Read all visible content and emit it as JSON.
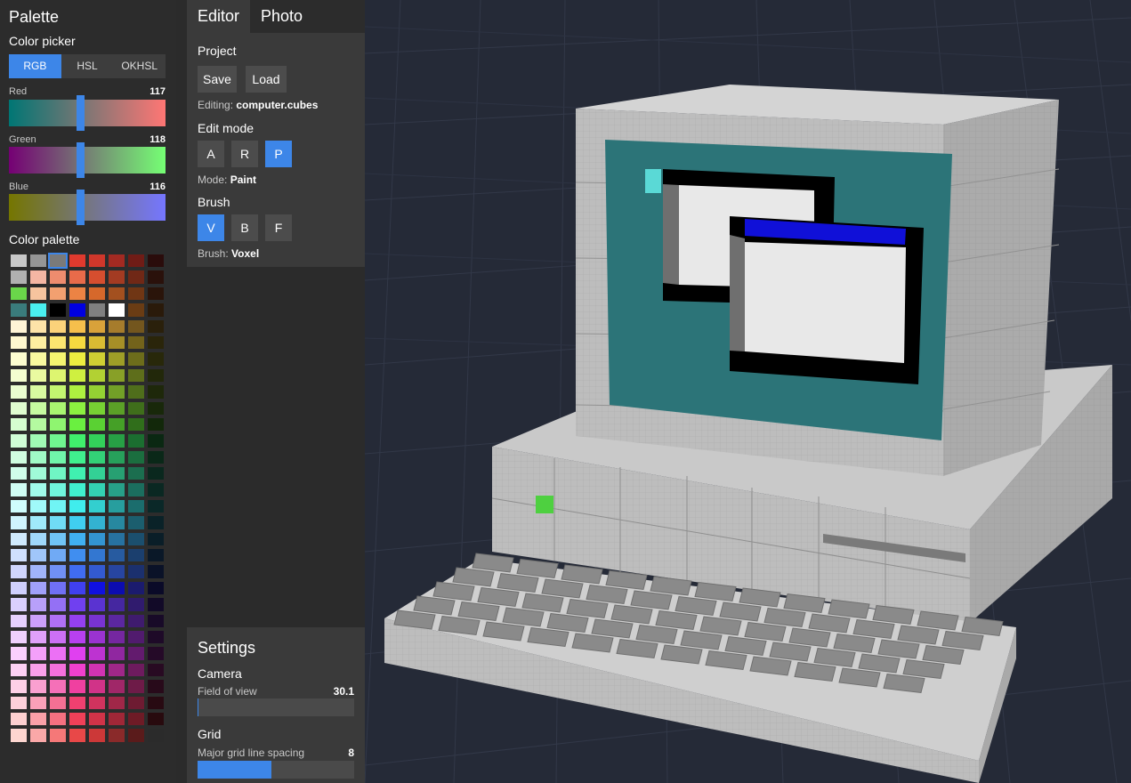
{
  "palette": {
    "title": "Palette",
    "color_picker_label": "Color picker",
    "modes": [
      "RGB",
      "HSL",
      "OKHSL"
    ],
    "active_mode": "RGB",
    "sliders": [
      {
        "label": "Red",
        "value": 117
      },
      {
        "label": "Green",
        "value": 118
      },
      {
        "label": "Blue",
        "value": 116
      }
    ],
    "color_palette_label": "Color palette",
    "swatches": [
      [
        "#c8c8c8",
        "#959595",
        "#7a7a7a",
        "#e03a2e",
        "#d0372b",
        "#a32a22",
        "#701c16",
        "#2a0c0b"
      ],
      [
        "#b0b0b0",
        "#f4b6a3",
        "#ee8c6e",
        "#e86b4a",
        "#d64e2f",
        "#a33b22",
        "#702816",
        "#2a110b"
      ],
      [
        "#6ad64a",
        "#f6c49e",
        "#f2a070",
        "#ec8344",
        "#d6682b",
        "#a3501f",
        "#703614",
        "#2a140a"
      ],
      [
        "#3a7c7c",
        "#4af0f0",
        "#000000",
        "#0000e0",
        "#808080",
        "#ffffff",
        "#6a3c14",
        "#2a1a0a"
      ],
      [
        "#fff4d6",
        "#fde3a8",
        "#fbd27a",
        "#f6bf4c",
        "#d9a23a",
        "#a67c2c",
        "#73561e",
        "#2a200b"
      ],
      [
        "#fff8d0",
        "#fdeea0",
        "#fbe570",
        "#f6d940",
        "#d9bb33",
        "#a68f27",
        "#73631b",
        "#2a250a"
      ],
      [
        "#fdfdd0",
        "#f9f9a0",
        "#f4f470",
        "#eded40",
        "#cfcf33",
        "#9e9e27",
        "#6d6d1b",
        "#28280a"
      ],
      [
        "#f4fdd0",
        "#eafaa0",
        "#ddf570",
        "#cff040",
        "#b2d133",
        "#88a027",
        "#5e6e1b",
        "#22280a"
      ],
      [
        "#eafdd0",
        "#d8faa0",
        "#c3f570",
        "#aef040",
        "#94d133",
        "#72a027",
        "#4f6e1b",
        "#1e280a"
      ],
      [
        "#e0fdd0",
        "#c6faa0",
        "#a9f570",
        "#8cf040",
        "#77d133",
        "#5ba027",
        "#3f6e1b",
        "#18280a"
      ],
      [
        "#d6fdd0",
        "#b4faa0",
        "#8ff570",
        "#6af040",
        "#5ad133",
        "#45a027",
        "#306e1b",
        "#12280a"
      ],
      [
        "#d0fdd6",
        "#a0fab4",
        "#70f590",
        "#40f06c",
        "#33d15a",
        "#27a045",
        "#1b6e30",
        "#0a2812"
      ],
      [
        "#d0fde0",
        "#a0fac6",
        "#70f5aa",
        "#40f08e",
        "#33d177",
        "#27a05b",
        "#1b6e3f",
        "#0a2818"
      ],
      [
        "#d0fdea",
        "#a0fad8",
        "#70f5c4",
        "#40f0b0",
        "#33d195",
        "#27a072",
        "#1b6e4f",
        "#0a281e"
      ],
      [
        "#d0fdf4",
        "#a0faea",
        "#70f5dc",
        "#40f0ce",
        "#33d1b2",
        "#27a088",
        "#1b6e5e",
        "#0a2822"
      ],
      [
        "#d0fdfd",
        "#a0f9f9",
        "#70f4f4",
        "#40eded",
        "#33cfcf",
        "#279e9e",
        "#1b6d6d",
        "#0a2828"
      ],
      [
        "#d0f4fd",
        "#a0eafa",
        "#70dcf5",
        "#40cef0",
        "#33b2d1",
        "#2788a0",
        "#1b5e6e",
        "#0a2228"
      ],
      [
        "#d0eafd",
        "#a0d8fa",
        "#70c4f5",
        "#40b0f0",
        "#3395d1",
        "#2772a0",
        "#1b4f6e",
        "#0a1e28"
      ],
      [
        "#d0e0fd",
        "#a0c6fa",
        "#70aaf5",
        "#408ef0",
        "#3377d1",
        "#275ba0",
        "#1b3f6e",
        "#0a1828"
      ],
      [
        "#d0d6fd",
        "#a0b4fa",
        "#7090f5",
        "#406cf0",
        "#335ad1",
        "#2745a0",
        "#1b306e",
        "#0a1228"
      ],
      [
        "#d0d0fd",
        "#a0a0fa",
        "#7070f5",
        "#4040f0",
        "#1010e0",
        "#0c0cb0",
        "#1b1b6e",
        "#0a0a28"
      ],
      [
        "#dad0fd",
        "#b8a0fa",
        "#9470f5",
        "#7040f0",
        "#5a33d1",
        "#4527a0",
        "#301b6e",
        "#120a28"
      ],
      [
        "#e6d0fd",
        "#cca0fa",
        "#b070f5",
        "#9440f0",
        "#7833d1",
        "#5b27a0",
        "#3f1b6e",
        "#180a28"
      ],
      [
        "#f0d0fd",
        "#e0a0fa",
        "#cc70f5",
        "#b840f0",
        "#9a33d1",
        "#7527a0",
        "#511b6e",
        "#1e0a28"
      ],
      [
        "#fad0fd",
        "#f4a0fa",
        "#ec70f5",
        "#e040f0",
        "#bd33d1",
        "#9027a0",
        "#631b6e",
        "#250a28"
      ],
      [
        "#fdd0f4",
        "#faa0ea",
        "#f570dc",
        "#f040ce",
        "#d133b2",
        "#a02788",
        "#6e1b5e",
        "#280a22"
      ],
      [
        "#fdd0e6",
        "#faa0d0",
        "#f570b8",
        "#f040a0",
        "#d13388",
        "#a02768",
        "#6e1b48",
        "#280a1a"
      ],
      [
        "#fdd0da",
        "#faa0b8",
        "#f57094",
        "#f04070",
        "#d1335e",
        "#a02748",
        "#6e1b32",
        "#280a12"
      ],
      [
        "#fdd0d0",
        "#faa0a8",
        "#f57080",
        "#f04058",
        "#d13348",
        "#a02737",
        "#6e1b26",
        "#280a0e"
      ],
      [
        "#fdd6d0",
        "#faa8a8",
        "#f57878",
        "#e84848",
        "#cc3838",
        "#8a2a2a",
        "#5a1b1b",
        "#2b2b2b"
      ]
    ],
    "selected_swatch": [
      0,
      2
    ]
  },
  "editor": {
    "tabs": [
      "Editor",
      "Photo"
    ],
    "active_tab": "Editor",
    "project_label": "Project",
    "save_label": "Save",
    "load_label": "Load",
    "editing_label": "Editing:",
    "editing_file": "computer.cubes",
    "edit_mode_label": "Edit mode",
    "edit_modes": [
      "A",
      "R",
      "P"
    ],
    "active_edit_mode": "P",
    "mode_label": "Mode:",
    "mode_value": "Paint",
    "brush_label": "Brush",
    "brushes": [
      "V",
      "B",
      "F"
    ],
    "active_brush": "V",
    "brush_info_label": "Brush:",
    "brush_value": "Voxel"
  },
  "settings": {
    "title": "Settings",
    "camera_label": "Camera",
    "fov_label": "Field of view",
    "fov_value": "30.1",
    "fov_fraction": 0.005,
    "grid_label": "Grid",
    "spacing_label": "Major grid line spacing",
    "spacing_value": "8",
    "spacing_fraction": 0.47
  },
  "viewport": {
    "background": "#252a37",
    "model": "voxel-computer"
  }
}
